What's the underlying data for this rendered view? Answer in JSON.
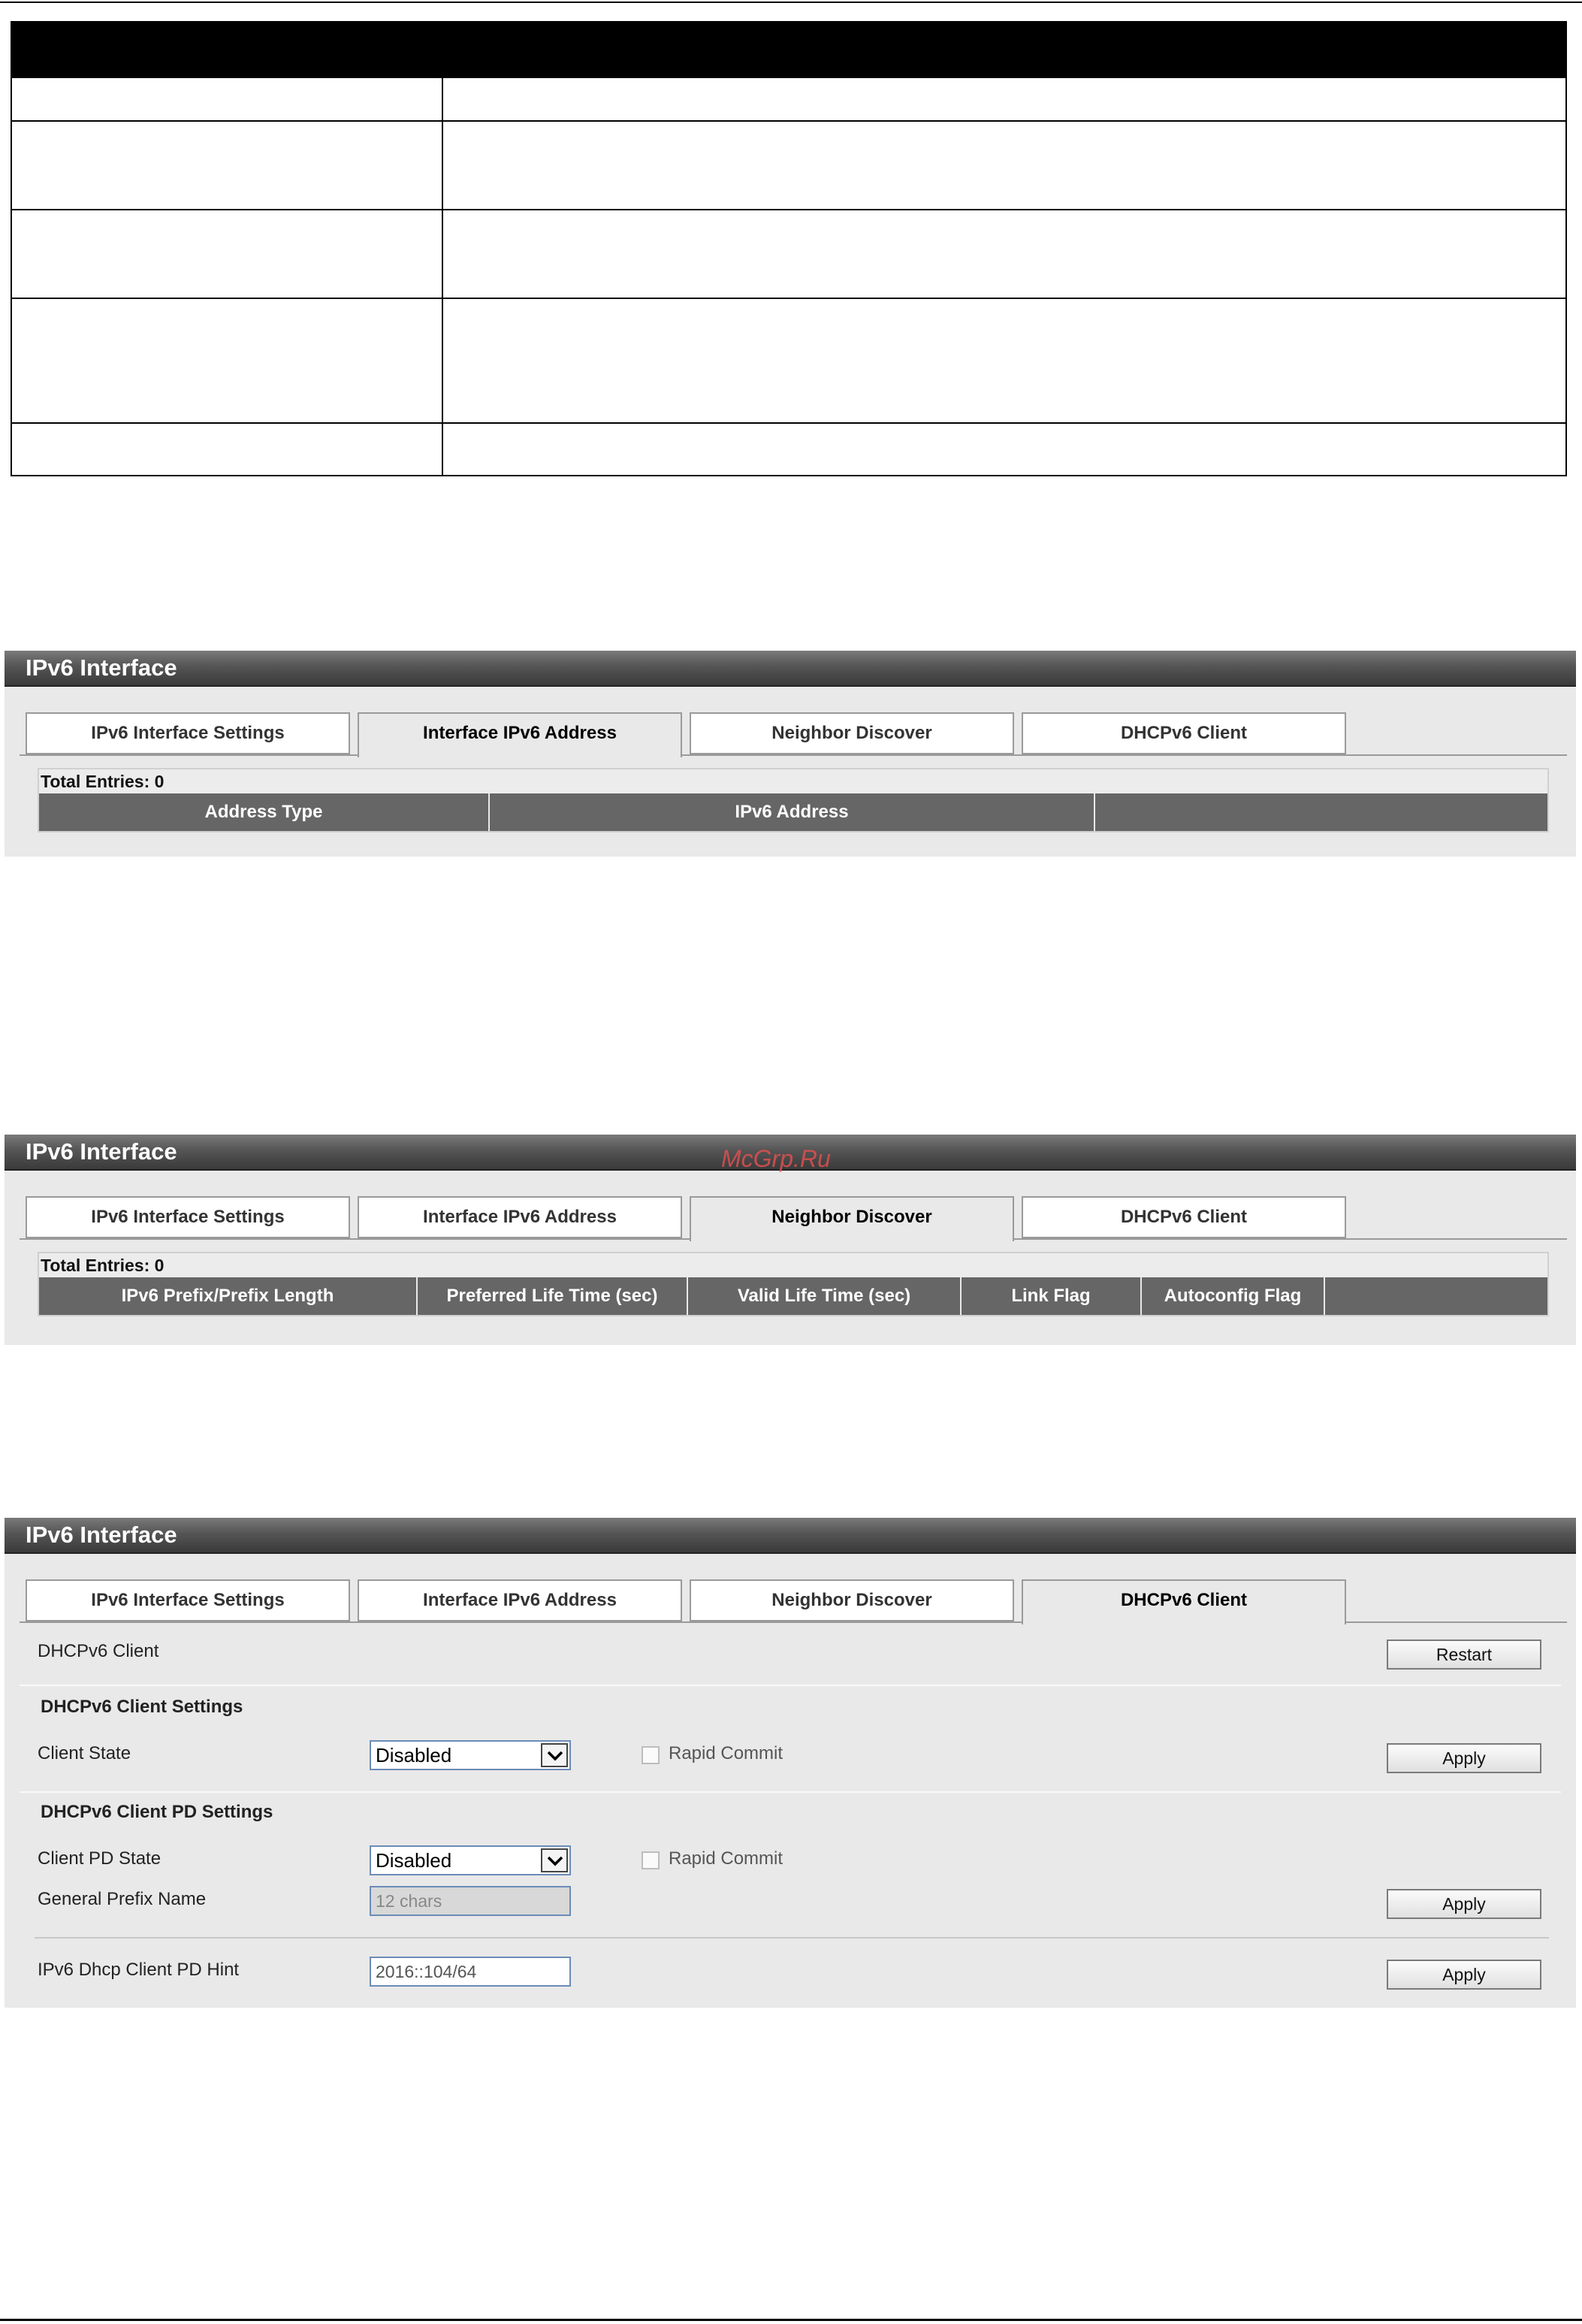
{
  "panel_title": "IPv6 Interface",
  "tabs": [
    "IPv6 Interface Settings",
    "Interface IPv6 Address",
    "Neighbor Discover",
    "DHCPv6 Client"
  ],
  "watermark": "McGrp.Ru",
  "address_panel": {
    "total_entries": "Total Entries: 0",
    "columns": [
      "Address Type",
      "IPv6 Address",
      ""
    ]
  },
  "neighbor_panel": {
    "total_entries": "Total Entries: 0",
    "columns": [
      "IPv6 Prefix/Prefix Length",
      "Preferred Life Time (sec)",
      "Valid Life Time (sec)",
      "Link Flag",
      "Autoconfig Flag",
      ""
    ]
  },
  "dhcp_panel": {
    "client_label": "DHCPv6 Client",
    "restart_button": "Restart",
    "client_settings_title": "DHCPv6 Client Settings",
    "client_state_label": "Client State",
    "client_state_value": "Disabled",
    "rapid_commit_label": "Rapid Commit",
    "apply_button": "Apply",
    "pd_settings_title": "DHCPv6 Client PD Settings",
    "client_pd_state_label": "Client PD State",
    "client_pd_state_value": "Disabled",
    "general_prefix_label": "General Prefix Name",
    "general_prefix_placeholder": "12 chars",
    "pd_hint_label": "IPv6 Dhcp Client PD Hint",
    "pd_hint_value": "2016::104/64"
  }
}
